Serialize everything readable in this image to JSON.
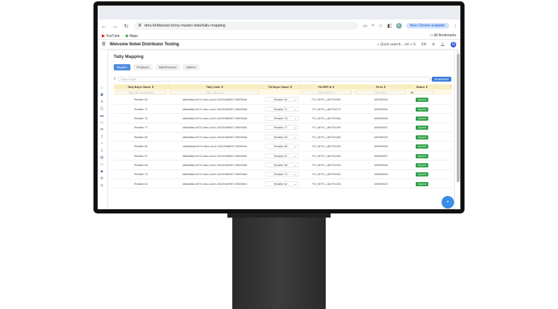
{
  "browser": {
    "url": "dms.fieldassist.io/my-master-data/tally-mapping",
    "chrome_update": "New Chrome available",
    "bookmarks": [
      "YouTube",
      "Maps"
    ],
    "all_bookmarks": "All Bookmarks"
  },
  "app": {
    "welcome": "Welcome Nobel Distributor Testing",
    "search_placeholder": "Quick search... ctrl + G",
    "language": "EN",
    "avatar_initial": "N"
  },
  "page": {
    "title": "Tally Mapping",
    "tabs": [
      "Buyers",
      "Products",
      "Warehouses",
      "Sellers"
    ],
    "active_tab": "Buyers",
    "search_placeholder": "Search table",
    "download_label": "Download"
  },
  "table": {
    "headers": [
      "Tally Buyer Name",
      "Tally Code",
      "FA Buyer Name",
      "FA ERP Id",
      "FA Id",
      "Status"
    ],
    "filters": [
      "Filter Tally Buyer Name",
      "Filter Tally Code",
      "",
      "Filter FA ERP Id",
      "Filter FA Id",
      "All"
    ],
    "rows": [
      {
        "name": "Retailer 82",
        "code": "d6a6d6da-b074-4acc-a1c4-104215d8937-000000cd",
        "fa_name": "Retailer 82",
        "erp": "FO_NHTC_d6279130S",
        "fa_id": "160090542",
        "status": "Synced"
      },
      {
        "name": "Retailer 71",
        "code": "d6a6d6da-b074-4acc-a1c4-104215d8937-000000d8",
        "fa_name": "Retailer 71",
        "erp": "FO_NHTC_d62791272",
        "fa_id": "160090531",
        "status": "Synced"
      },
      {
        "name": "Retailer 75",
        "code": "d6a6d6da-b074-4acc-a1c4-104215d8937-000000dd",
        "fa_name": "Retailer 75",
        "erp": "FO_NHTC_d62791284",
        "fa_id": "160090535",
        "status": "Synced"
      },
      {
        "name": "Retailer 77",
        "code": "d6a6d6da-b074-4acc-a1c4-104215d8937-000000d2",
        "fa_name": "Retailer 77",
        "erp": "FO_NHTC_d62791290",
        "fa_id": "160090537",
        "status": "Synced"
      },
      {
        "name": "Retailer 69",
        "code": "d6a6d6da-b074-4acc-a1c4-104215d8937-000000da",
        "fa_name": "Retailer 69",
        "erp": "FO_NHTC_d62791266",
        "fa_id": "160090529",
        "status": "Synced"
      },
      {
        "name": "Retailer 80",
        "code": "d6a6d6da-b074-4acc-a1c4-104215d8937-000000cf",
        "fa_name": "Retailer 80",
        "erp": "FO_NHTC_d62791299",
        "fa_id": "160090540",
        "status": "Synced"
      },
      {
        "name": "Retailer 67",
        "code": "d6a6d6da-b074-4acc-a1c4-104215d8937-000000dc",
        "fa_name": "Retailer 67",
        "erp": "FO_NHTC_d62791260",
        "fa_id": "160090527",
        "status": "Synced"
      },
      {
        "name": "Retailer 68",
        "code": "d6a6d6da-b074-4acc-a1c4-104215d8937-000000db",
        "fa_name": "Retailer 68",
        "erp": "FO_NHTC_d62791263",
        "fa_id": "160090528",
        "status": "Synced"
      },
      {
        "name": "Retailer 74",
        "code": "d6a6d6da-b074-4acc-a1c4-104215d8937-000000d0",
        "fa_name": "Retailer 74",
        "erp": "FO_NHTC_d62791281",
        "fa_id": "160090534",
        "status": "Synced"
      },
      {
        "name": "Retailer 62",
        "code": "d6a6d6da-b074-4acc-a1c4-104215d8937-000000e1",
        "fa_name": "Retailer 62",
        "erp": "FO_NHTC_d62791245",
        "fa_id": "160090522",
        "status": "Synced"
      }
    ]
  },
  "colors": {
    "accent": "#3a78d6",
    "header_bg": "#faedc1",
    "synced": "#2e9e48"
  }
}
